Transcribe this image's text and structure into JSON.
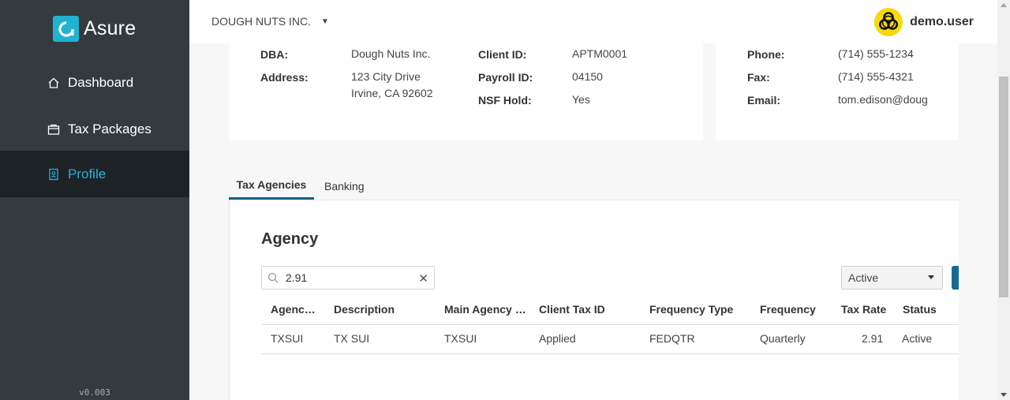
{
  "app": {
    "logo_text": "Asure",
    "version": "v0.003"
  },
  "sidebar": {
    "items": [
      {
        "label": "Dashboard",
        "icon": "home-icon"
      },
      {
        "label": "Tax Packages",
        "icon": "package-icon"
      },
      {
        "label": "Profile",
        "icon": "badge-icon",
        "active": true
      }
    ]
  },
  "header": {
    "company": "DOUGH NUTS INC.",
    "user": "demo.user"
  },
  "info": {
    "dba_label": "DBA:",
    "dba": "Dough Nuts Inc.",
    "address_label": "Address:",
    "address_line1": "123 City Drive",
    "address_line2": "Irvine, CA 92602",
    "client_id_label": "Client ID:",
    "client_id": "APTM0001",
    "payroll_id_label": "Payroll ID:",
    "payroll_id": "04150",
    "nsf_label": "NSF Hold:",
    "nsf": "Yes",
    "phone_label": "Phone:",
    "phone": "(714) 555-1234",
    "fax_label": "Fax:",
    "fax": "(714) 555-4321",
    "email_label": "Email:",
    "email": "tom.edison@doug"
  },
  "tabs": {
    "agencies": "Tax Agencies",
    "banking": "Banking"
  },
  "agency": {
    "title": "Agency",
    "search_value": "2.91",
    "status_filter": "Active",
    "columns": [
      "Agenc…",
      "Description",
      "Main Agency …",
      "Client Tax ID",
      "Frequency Type",
      "Frequency",
      "Tax Rate",
      "Status"
    ],
    "rows": [
      [
        "TXSUI",
        "TX SUI",
        "TXSUI",
        "Applied",
        "FEDQTR",
        "Quarterly",
        "2.91",
        "Active"
      ]
    ]
  },
  "colors": {
    "sidebar_bg": "#333a40",
    "active_bg": "#1d2227",
    "accent": "#27b0d9",
    "tab_underline": "#1b5e89",
    "button": "#146a93"
  }
}
